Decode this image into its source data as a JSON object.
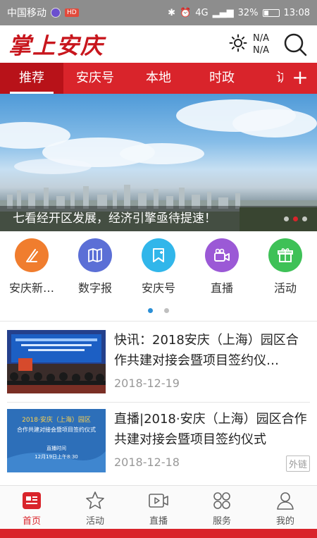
{
  "status_bar": {
    "carrier": "中国移动",
    "badge": "HD",
    "signal": "4G",
    "battery": "32%",
    "time": "13:08"
  },
  "header": {
    "logo": "掌上安庆",
    "weather_top": "N/A",
    "weather_bottom": "N/A"
  },
  "tabs": [
    {
      "label": "推荐"
    },
    {
      "label": "安庆号"
    },
    {
      "label": "本地"
    },
    {
      "label": "时政"
    },
    {
      "label": "访"
    }
  ],
  "tab_add": "+",
  "hero": {
    "caption": "七看经开区发展，经济引擎亟待提速！",
    "slide_count": 3,
    "active_slide": 1
  },
  "quick_entries": [
    {
      "label": "安庆新…",
      "icon": "feather-icon",
      "color": "#f07d2e"
    },
    {
      "label": "数字报",
      "icon": "newspaper-icon",
      "color": "#5b6fd6"
    },
    {
      "label": "安庆号",
      "icon": "bookmark-icon",
      "color": "#31b6ea"
    },
    {
      "label": "直播",
      "icon": "video-camera-icon",
      "color": "#9b59d6"
    },
    {
      "label": "活动",
      "icon": "gift-icon",
      "color": "#3ec157"
    }
  ],
  "news": [
    {
      "title": "快讯：2018安庆（上海）园区合作共建对接会暨项目签约仪…",
      "date": "2018-12-19",
      "tag": ""
    },
    {
      "title": "直播|2018·安庆（上海）园区合作共建对接会暨项目签约仪式",
      "date": "2018-12-18",
      "tag": "外链",
      "thumb_title": "2018·安庆（上海）园区",
      "thumb_subtitle": "合作共建对接会暨项目签约仪式",
      "thumb_time_label": "直播时间",
      "thumb_time": "12月19日上午8:30"
    }
  ],
  "bottom_nav": [
    {
      "label": "首页",
      "icon": "home-news-icon",
      "active": true
    },
    {
      "label": "活动",
      "icon": "star-icon",
      "active": false
    },
    {
      "label": "直播",
      "icon": "play-video-icon",
      "active": false
    },
    {
      "label": "服务",
      "icon": "grid-icon",
      "active": false
    },
    {
      "label": "我的",
      "icon": "user-icon",
      "active": false
    }
  ],
  "colors": {
    "brand_red": "#d9242b",
    "active_dot": "#2b8fd6"
  }
}
